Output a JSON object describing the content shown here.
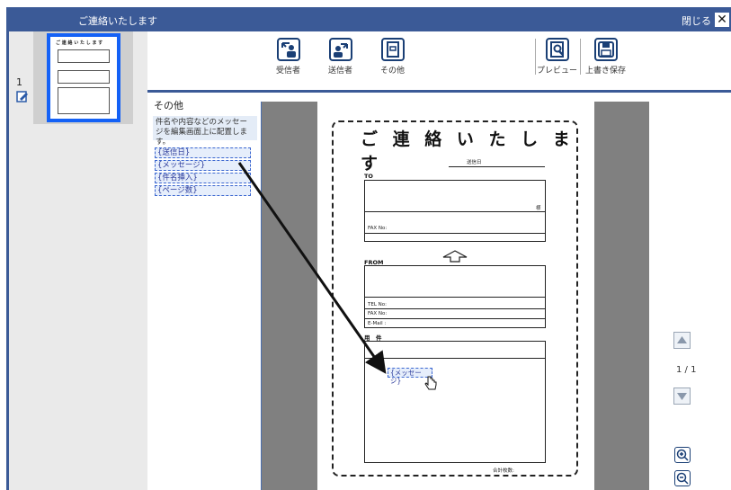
{
  "window": {
    "title": "ご連絡いたします",
    "close_label": "閉じる",
    "close_glyph": "✕"
  },
  "thumbnails": {
    "page_number": "1",
    "thumb_title": "ご 連 絡 い た し ま す"
  },
  "toolbar": {
    "buttons": [
      {
        "label": "受信者",
        "icon": "recipient-icon"
      },
      {
        "label": "送信者",
        "icon": "sender-icon"
      },
      {
        "label": "その他",
        "icon": "other-icon"
      },
      {
        "label": "プレビュー",
        "icon": "preview-icon"
      },
      {
        "label": "上書き保存",
        "icon": "save-icon"
      }
    ]
  },
  "other_panel": {
    "title": "その他",
    "description": "件名や内容などのメッセージを編集画面上に配置します。",
    "fields": [
      "{送信日}",
      "{メッセージ}",
      "{件名挿入}",
      "{ページ数}"
    ]
  },
  "document": {
    "title": "ご 連 絡 い た し ま す",
    "send_date_label": "送信日",
    "to_label": "TO",
    "honorific": "様",
    "fax_to_label": "FAX No:",
    "from_label": "FROM",
    "tel_label": "TEL No:",
    "fax_from_label": "FAX No:",
    "email_label": "E-Mail :",
    "subject_label": "用　件",
    "placed_field": "{メッセージ}",
    "total_pages_label": "合計枚数:"
  },
  "navigation": {
    "page_count": "1 / 1"
  },
  "colors": {
    "titlebar": "#3b5a97",
    "selection": "#1461f6",
    "canvas": "#808080"
  }
}
